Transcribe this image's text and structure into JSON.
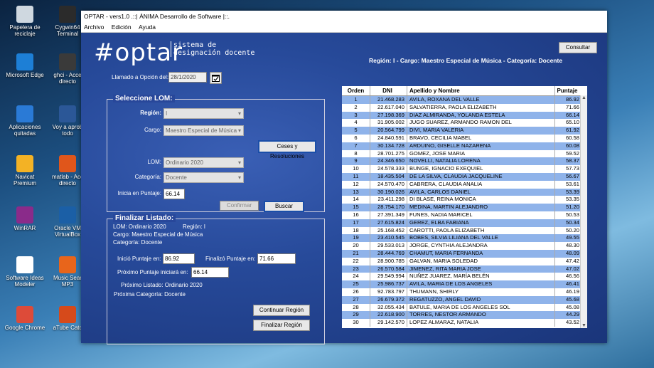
{
  "desktop": {
    "icons": [
      {
        "label": "Papelera de\nreciclaje",
        "color": "#cfd8e0"
      },
      {
        "label": "Cygwin64\nTerminal",
        "color": "#2b2b2b"
      },
      {
        "label": "Microsoft Edge",
        "color": "#1d7fd6"
      },
      {
        "label": "ghci - Acce\ndirecto",
        "color": "#3a3a3a"
      },
      {
        "label": "Aplicaciones\nquitadas",
        "color": "#2a7ad6"
      },
      {
        "label": "Voy a aprob\ntodo",
        "color": "#2b5797"
      },
      {
        "label": "Navicat Premium",
        "color": "#f3b225"
      },
      {
        "label": "matlab - Acc\ndirecto",
        "color": "#e0561b"
      },
      {
        "label": "WinRAR",
        "color": "#8a2b8a"
      },
      {
        "label": "Oracle VM\nVirtualBox",
        "color": "#1b5fa6"
      },
      {
        "label": "Software Ideas\nModeler",
        "color": "#ffffff"
      },
      {
        "label": "Music Sear\nMP3",
        "color": "#e8651b"
      },
      {
        "label": "Google Chrome",
        "color": "#dd4b39"
      },
      {
        "label": "aTube Catc",
        "color": "#d64a1b"
      }
    ]
  },
  "window": {
    "title": "OPTAR - vers1.0 .::| ÁNIMA Desarrollo de Software |::.",
    "menu": [
      "Archivo",
      "Edición",
      "Ayuda"
    ]
  },
  "header": {
    "logo": "#optar",
    "logo_sub_line1": "sistema de",
    "logo_sub_line2": "designación docente",
    "consult_button": "Consultar",
    "summary": "Región: I  - Cargo: Maestro Especial de Música  - Categoría: Docente"
  },
  "call": {
    "label": "Llamado a Opción del:",
    "date": "28/1/2020"
  },
  "select_group": {
    "title": "Seleccione LOM:",
    "region_label": "Región:",
    "region_value": "I",
    "cargo_label": "Cargo:",
    "cargo_value": "Maestro Especial de Música",
    "ceses_button": "Ceses y Resoluciones",
    "lom_label": "LOM:",
    "lom_value": "Ordinario 2020",
    "categoria_label": "Categoría:",
    "categoria_value": "Docente",
    "inicia_label": "Inicia en Puntaje:",
    "inicia_value": "66.14",
    "confirm_button": "Confirmar",
    "search_button": "Buscar"
  },
  "finalize_group": {
    "title": "Finalizar Listado:",
    "line_lom": "LOM: Ordinario 2020",
    "line_region": "Región: I",
    "line_cargo": "Cargo: Maestro Especial de Música",
    "line_categoria": "Categoría: Docente",
    "start_label": "Inició Puntaje en:",
    "start_value": "86.92",
    "end_label": "Finalizó Puntaje en:",
    "end_value": "71.66",
    "next_label": "Próximo Puntaje iniciará en:",
    "next_value": "66.14",
    "next_list": "Próximo Listado: Ordinario 2020",
    "next_category": "Próxima Categoría: Docente",
    "continue_button": "Continuar Región",
    "finish_button": "Finalizar Región"
  },
  "table": {
    "headers": [
      "Orden",
      "DNI",
      "Apellido y Nombre",
      "Puntaje"
    ],
    "rows": [
      [
        "1",
        "21.468.283",
        "AVILA, ROXANA DEL VALLE",
        "86.92"
      ],
      [
        "2",
        "22.617.040",
        "SALVATIERRA, PAOLA  ELIZABETH",
        "71.66"
      ],
      [
        "3",
        "27.198.369",
        "DIAZ ALMIRANDA, YOLANDA ESTELA",
        "66.14"
      ],
      [
        "4",
        "31.905.002",
        "JUGO SUAREZ, ARMANDO RAMON DEL",
        "65.10"
      ],
      [
        "5",
        "20.564.799",
        "DIVI, MARIA VALERIA",
        "61.92"
      ],
      [
        "6",
        "24.840.591",
        "BRAVO, CECILIA MABEL",
        "60.58"
      ],
      [
        "7",
        "30.134.728",
        "ARDUINO, GISELLE NAZARENA",
        "60.08"
      ],
      [
        "8",
        "28.701.275",
        "GOMEZ, JOSE MARIA",
        "59.52"
      ],
      [
        "9",
        "24.346.650",
        "NOVELLI, NATALIA LORENA",
        "58.37"
      ],
      [
        "10",
        "24.578.333",
        "BUNGE, IGNACIO EXEQUIEL",
        "57.73"
      ],
      [
        "11",
        "18.435.504",
        "DE LA SILVA, CLAUDIA JACQUELINE",
        "56.67"
      ],
      [
        "12",
        "24.570.470",
        "CABRERA, CLAUDIA ANALIA",
        "53.61"
      ],
      [
        "13",
        "30.190.026",
        "AVILA, CARLOS DANIEL",
        "53.39"
      ],
      [
        "14",
        "23.411.298",
        "DI BLASE, REINA MONICA",
        "53.35"
      ],
      [
        "15",
        "28.754.170",
        "MEDINA, MARTIN ALEJANDRO",
        "51.20"
      ],
      [
        "16",
        "27.391.349",
        "FUNES, NADIA MARICEL",
        "50.53"
      ],
      [
        "17",
        "27.615.824",
        "GEREZ, ELBA FABIANA",
        "50.34"
      ],
      [
        "18",
        "25.168.452",
        "CAROTTI, PAOLA ELIZABETH",
        "50.20"
      ],
      [
        "19",
        "23.410.545",
        "BOBES, SILVIA LILIANA DEL VALLE",
        "49.55"
      ],
      [
        "20",
        "29.533.013",
        "JORGE, CYNTHIA ALEJANDRA",
        "48.30"
      ],
      [
        "21",
        "28.444.769",
        "CHAMUT, MARIA FERNANDA",
        "48.09"
      ],
      [
        "22",
        "28.900.785",
        "GALVAN, MARIA SOLEDAD",
        "47.42"
      ],
      [
        "23",
        "26.570.584",
        "JIMENEZ, RITA MARIA JOSE",
        "47.02"
      ],
      [
        "24",
        "29.549.994",
        "NUÑEZ JUAREZ, MARÍA BELÉN",
        "46.56"
      ],
      [
        "25",
        "25.986.737",
        "AVILA, MARIA DE LOS ANGELES",
        "46.41"
      ],
      [
        "26",
        "92.783.797",
        "THUMANN, SHIRLY",
        "46.19"
      ],
      [
        "27",
        "26.679.372",
        "REGATUZZO, ANGEL DAVID",
        "45.68"
      ],
      [
        "28",
        "32.055.434",
        "BATULE, MARIA DE LOS ANGELES SOL",
        "45.08"
      ],
      [
        "29",
        "22.618.900",
        "TORRES, NESTOR ARMANDO",
        "44.29"
      ],
      [
        "30",
        "29.142.570",
        "LOPEZ ALMARAZ, NATALIA",
        "43.52"
      ]
    ]
  }
}
